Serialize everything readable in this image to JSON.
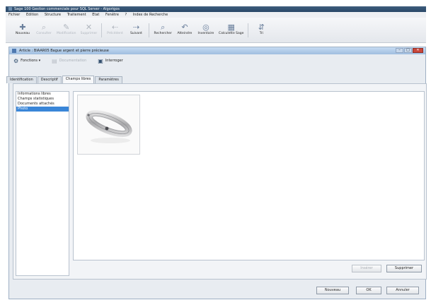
{
  "app": {
    "title": "Sage 100 Gestion commerciale pour SQL Server - Algorigos"
  },
  "menubar": [
    "Fichier",
    "Edition",
    "Structure",
    "Traitement",
    "Etat",
    "Fenêtre",
    "?",
    "Index de Recherche"
  ],
  "toolbar": {
    "buttons": [
      {
        "label": "Nouveau",
        "icon": "plus-icon",
        "glyph": "✚",
        "disabled": false
      },
      {
        "label": "Consulter",
        "icon": "view-icon",
        "glyph": "⌕",
        "disabled": true
      },
      {
        "label": "Modification",
        "icon": "edit-icon",
        "glyph": "✎",
        "disabled": true
      },
      {
        "label": "Supprimer",
        "icon": "delete-icon",
        "glyph": "✕",
        "disabled": true
      },
      {
        "label": "Précédent",
        "icon": "back-icon",
        "glyph": "⇠",
        "disabled": true
      },
      {
        "label": "Suivant",
        "icon": "next-icon",
        "glyph": "⇢",
        "disabled": false
      },
      {
        "label": "Rechercher",
        "icon": "search-icon",
        "glyph": "⌕",
        "disabled": false
      },
      {
        "label": "Atteindre",
        "icon": "goto-icon",
        "glyph": "↶",
        "disabled": false
      },
      {
        "label": "Inventaire",
        "icon": "inventory-icon",
        "glyph": "◎",
        "disabled": false
      },
      {
        "label": "Calculette Sage",
        "icon": "calculator-icon",
        "glyph": "▦",
        "disabled": false
      },
      {
        "label": "Tri",
        "icon": "sort-icon",
        "glyph": "⇵",
        "disabled": false
      }
    ]
  },
  "child_window": {
    "title": "Article : BIAAR05 Bague argent et pierre précieuse",
    "toolbar": [
      {
        "label": "Fonctions",
        "icon": "functions-icon",
        "glyph": "⚙",
        "disabled": false
      },
      {
        "label": "Documentation",
        "icon": "documentation-icon",
        "glyph": "▤",
        "disabled": true
      },
      {
        "label": "Interroger",
        "icon": "query-icon",
        "glyph": "▣",
        "disabled": false
      }
    ],
    "tabs": [
      {
        "label": "Identification",
        "active": false
      },
      {
        "label": "Descriptif",
        "active": false
      },
      {
        "label": "Champs libres",
        "active": true
      },
      {
        "label": "Paramètres",
        "active": false
      }
    ],
    "nav": [
      {
        "label": "Informations libres",
        "selected": false
      },
      {
        "label": "Champs statistiques",
        "selected": false
      },
      {
        "label": "Documents attachés",
        "selected": false
      },
      {
        "label": "Photo",
        "selected": true
      }
    ],
    "photo_alt": "ring-photo",
    "buttons": {
      "insert": "Insérer",
      "delete": "Supprimer"
    }
  },
  "footer": {
    "new": "Nouveau",
    "ok": "OK",
    "cancel": "Annuler"
  }
}
